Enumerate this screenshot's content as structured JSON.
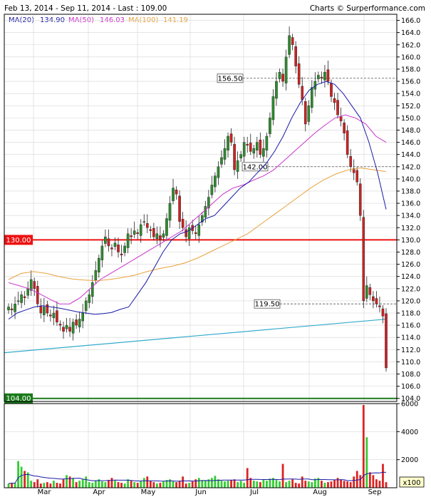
{
  "header": {
    "title": "Feb 13, 2014 - Sep 11, 2014 - Last : 109.00",
    "credit": "Charts © Surperformance.com"
  },
  "legend": [
    {
      "label": "MA(20)",
      "value": "134.90",
      "color": "#1a1aa8"
    },
    {
      "label": "MA(50)",
      "value": "146.03",
      "color": "#cc33cc"
    },
    {
      "label": "MA(100)",
      "value": "141.19",
      "color": "#e8a23c"
    }
  ],
  "colors": {
    "up": "#2e8b2e",
    "down": "#cc2222",
    "resistance": "#ee1111",
    "support": "#1a7a1a",
    "trend": "#33aacc",
    "grid": "#d6d6d6",
    "volume_ma": "#1a1aa8"
  },
  "chart_data": {
    "type": "candlestick",
    "x_labels": [
      "Mar",
      "Apr",
      "May",
      "Jun",
      "Jul",
      "Aug",
      "Sep"
    ],
    "ylim": [
      103.5,
      167
    ],
    "y_ticks": [
      104,
      106,
      108,
      110,
      112,
      114,
      116,
      118,
      120,
      122,
      124,
      126,
      128,
      130,
      132,
      134,
      136,
      138,
      140,
      142,
      144,
      146,
      148,
      150,
      152,
      154,
      156,
      158,
      160,
      162,
      164,
      166
    ],
    "y_tick_labels": [
      "104.0",
      "106.0",
      "108.0",
      "110.0",
      "112.0",
      "114.0",
      "116.0",
      "118.0",
      "120.0",
      "122.0",
      "124.0",
      "126.0",
      "128.0",
      "130.0",
      "132.0",
      "134.0",
      "136.0",
      "138.0",
      "140.0",
      "142.0",
      "144.0",
      "146.0",
      "148.0",
      "150.0",
      "152.0",
      "154.0",
      "156.0",
      "158.0",
      "160.0",
      "162.0",
      "164.0",
      "166.0"
    ],
    "horizontal_lines": [
      {
        "value": 130.0,
        "label": "130.00",
        "style": "resistance"
      },
      {
        "value": 104.0,
        "label": "104.00",
        "style": "support"
      },
      {
        "value": 156.5,
        "label": "156.50",
        "style": "dashed"
      },
      {
        "value": 142.0,
        "label": "142.00",
        "style": "dashed"
      },
      {
        "value": 119.5,
        "label": "119.50",
        "style": "dashed"
      }
    ],
    "trendline": {
      "start": 111.5,
      "end": 117.0
    },
    "closes": [
      119.0,
      118.5,
      119.5,
      120.0,
      121.0,
      120.5,
      122.0,
      123.5,
      122.0,
      119.5,
      118.0,
      119.0,
      118.0,
      117.5,
      118.0,
      116.5,
      116.0,
      115.0,
      116.0,
      115.0,
      116.5,
      116.0,
      117.0,
      118.0,
      120.0,
      121.0,
      123.0,
      125.0,
      127.0,
      129.0,
      130.5,
      129.0,
      128.5,
      129.5,
      128.0,
      127.5,
      129.0,
      131.0,
      130.5,
      131.5,
      131.0,
      132.5,
      133.0,
      132.0,
      131.5,
      130.5,
      131.0,
      130.0,
      131.0,
      133.5,
      136.0,
      138.5,
      137.5,
      133.0,
      132.0,
      130.5,
      132.0,
      131.5,
      131.0,
      132.5,
      134.0,
      135.5,
      137.0,
      139.0,
      140.5,
      142.0,
      143.5,
      145.0,
      147.0,
      146.0,
      141.5,
      143.0,
      144.0,
      146.0,
      145.5,
      144.5,
      145.0,
      146.0,
      144.0,
      145.0,
      147.0,
      150.0,
      153.5,
      156.0,
      157.5,
      156.0,
      160.0,
      163.5,
      162.0,
      158.5,
      155.5,
      153.0,
      149.0,
      152.0,
      155.0,
      156.0,
      157.0,
      156.5,
      157.5,
      156.0,
      153.5,
      152.5,
      150.5,
      149.5,
      147.5,
      144.0,
      142.0,
      141.0,
      139.5,
      134.0,
      120.0,
      122.5,
      121.0,
      120.0,
      119.5,
      119.0,
      117.5,
      109.0
    ],
    "ma20": [
      117,
      118,
      118.5,
      119,
      119.2,
      119,
      118.8,
      118.5,
      118.2,
      118,
      117.8,
      117.9,
      118.1,
      118.6,
      119,
      121,
      123,
      125.5,
      128,
      130,
      131,
      131.5,
      132.5,
      133.5,
      134,
      135.5,
      137,
      138.5,
      139.5,
      141,
      142.5,
      144.5,
      147,
      150,
      152.5,
      154.5,
      155.5,
      156,
      155.5,
      154,
      152,
      150,
      146,
      141,
      135
    ],
    "ma50": [
      123,
      122.5,
      122,
      121.2,
      120.3,
      119.5,
      119.5,
      120.5,
      122,
      123.5,
      124.5,
      125.5,
      126.5,
      127.5,
      128.5,
      129.5,
      130.5,
      131.5,
      133,
      134.5,
      136,
      137.5,
      138.5,
      139,
      139.8,
      140.5,
      141.5,
      143,
      144.5,
      146,
      147.5,
      148.8,
      150,
      150.5,
      150,
      149,
      147,
      146
    ],
    "ma100": [
      123.5,
      124.5,
      124.8,
      124.5,
      124,
      123.6,
      123.4,
      123.3,
      123.5,
      123.8,
      124.2,
      124.8,
      125.3,
      125.7,
      126.2,
      127,
      128,
      129,
      130,
      131,
      132.5,
      134,
      135.5,
      137,
      138.5,
      139.8,
      140.8,
      141.5,
      141.8,
      141.5,
      141.2
    ],
    "volume_ticks": [
      2000,
      4000,
      6000
    ],
    "volume_unit": "x100",
    "volume_ylim": [
      0,
      6000
    ],
    "volumes": [
      300,
      350,
      320,
      1900,
      1500,
      1200,
      1100,
      500,
      400,
      600,
      300,
      350,
      400,
      300,
      500,
      350,
      300,
      600,
      900,
      800,
      700,
      400,
      500,
      600,
      800,
      400,
      350,
      500,
      600,
      450,
      400,
      550,
      700,
      500,
      400,
      350,
      300,
      600,
      500,
      400,
      350,
      450,
      700,
      800,
      500,
      400,
      300,
      350,
      450,
      550,
      600,
      450,
      400,
      500,
      800,
      300,
      350,
      450,
      600,
      700,
      550,
      500,
      600,
      700,
      850,
      600,
      500,
      450,
      500,
      550,
      600,
      400,
      500,
      350,
      1400,
      700,
      500,
      450,
      400,
      600,
      500,
      650,
      700,
      550,
      450,
      1700,
      400,
      500,
      600,
      350,
      300,
      800,
      500,
      450,
      400,
      650,
      700,
      500,
      350,
      400,
      450,
      550,
      700,
      600,
      500,
      450,
      400,
      800,
      1200,
      900,
      5900,
      3600,
      1100,
      900,
      600,
      500,
      1700,
      400
    ]
  }
}
